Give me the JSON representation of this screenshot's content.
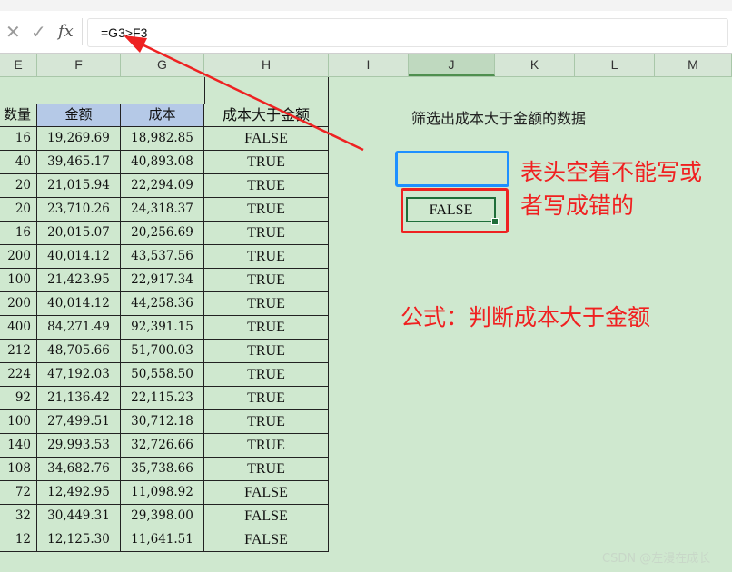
{
  "formula_bar": {
    "cancel_icon": "✕",
    "confirm_icon": "✓",
    "fx_label": "fx",
    "formula": "=G3>F3"
  },
  "columns": [
    "E",
    "F",
    "G",
    "H",
    "I",
    "J",
    "K",
    "L",
    "M"
  ],
  "selected_column": "J",
  "table": {
    "headers": [
      "数量",
      "金额",
      "成本",
      "成本大于金额"
    ],
    "rows": [
      [
        "16",
        "19,269.69",
        "18,982.85",
        "FALSE"
      ],
      [
        "40",
        "39,465.17",
        "40,893.08",
        "TRUE"
      ],
      [
        "20",
        "21,015.94",
        "22,294.09",
        "TRUE"
      ],
      [
        "20",
        "23,710.26",
        "24,318.37",
        "TRUE"
      ],
      [
        "16",
        "20,015.07",
        "20,256.69",
        "TRUE"
      ],
      [
        "200",
        "40,014.12",
        "43,537.56",
        "TRUE"
      ],
      [
        "100",
        "21,423.95",
        "22,917.34",
        "TRUE"
      ],
      [
        "200",
        "40,014.12",
        "44,258.36",
        "TRUE"
      ],
      [
        "400",
        "84,271.49",
        "92,391.15",
        "TRUE"
      ],
      [
        "212",
        "48,705.66",
        "51,700.03",
        "TRUE"
      ],
      [
        "224",
        "47,192.03",
        "50,558.50",
        "TRUE"
      ],
      [
        "92",
        "21,136.42",
        "22,115.23",
        "TRUE"
      ],
      [
        "100",
        "27,499.51",
        "30,712.18",
        "TRUE"
      ],
      [
        "140",
        "29,993.53",
        "32,726.66",
        "TRUE"
      ],
      [
        "108",
        "34,682.76",
        "35,738.66",
        "TRUE"
      ],
      [
        "72",
        "12,492.95",
        "11,098.92",
        "FALSE"
      ],
      [
        "32",
        "30,449.31",
        "29,398.00",
        "FALSE"
      ],
      [
        "12",
        "12,125.30",
        "11,641.51",
        "FALSE"
      ]
    ]
  },
  "annotations": {
    "criteria_text": "筛选出成本大于金额的数据",
    "criteria_header_value": "",
    "criteria_result": "FALSE",
    "note_line1": "表头空着不能写或",
    "note_line2": "者写成错的",
    "formula_note": "公式：判断成本大于金额"
  },
  "watermark": "CSDN @左漫在成长",
  "colors": {
    "sheet_bg": "#cfe8cf",
    "header_blue": "#b5c9e7",
    "annotation_red": "#f02020",
    "highlight_blue": "#1e90ff"
  }
}
